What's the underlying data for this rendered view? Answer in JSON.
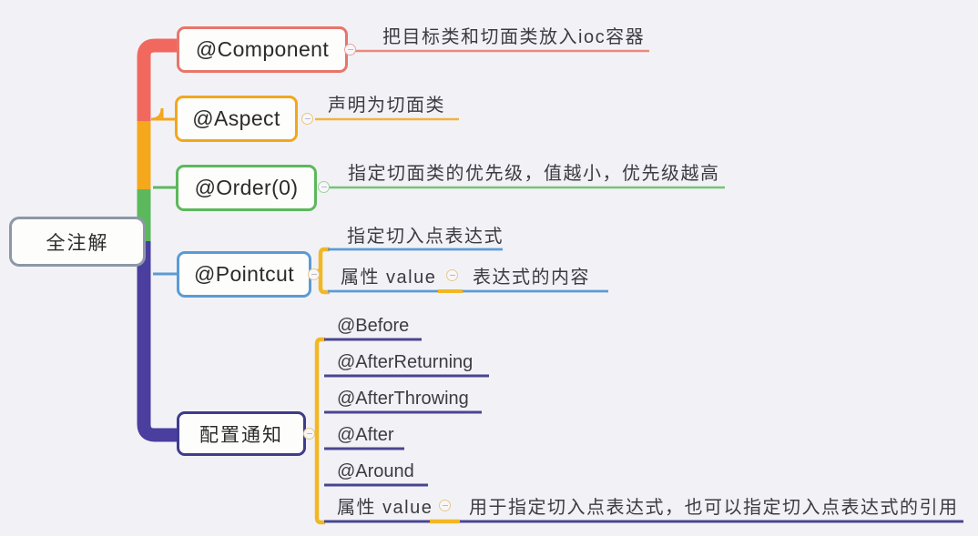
{
  "background": "#f2f2f6",
  "root": {
    "label": "全注解",
    "border_color": "#8d97a8"
  },
  "branches": [
    {
      "id": "component",
      "label": "@Component",
      "color": "#e8756a",
      "description": "把目标类和切面类放入ioc容器",
      "toggle": "collapse-toggle"
    },
    {
      "id": "aspect",
      "label": "@Aspect",
      "color": "#f2a71c",
      "description": "声明为切面类",
      "toggle": "collapse-toggle"
    },
    {
      "id": "order",
      "label": "@Order(0)",
      "color": "#5cb85c",
      "description": "指定切面类的优先级，值越小，优先级越高",
      "toggle": "collapse-toggle"
    },
    {
      "id": "pointcut",
      "label": "@Pointcut",
      "color": "#5b9bd5",
      "bracket_color": "#f2b723",
      "toggle": "collapse-toggle",
      "children": [
        {
          "label": "指定切入点表达式",
          "underline_color": "#5b9bd5"
        },
        {
          "label": "属性 value",
          "underline_color": "#5b9bd5",
          "toggle": "collapse-toggle",
          "detail": "表达式的内容"
        }
      ]
    },
    {
      "id": "advice",
      "label": "配置通知",
      "color": "#3f3c8c",
      "bracket_color": "#f2b723",
      "toggle": "collapse-toggle",
      "children": [
        {
          "label": "@Before",
          "underline_color": "#4a4591"
        },
        {
          "label": "@AfterReturning",
          "underline_color": "#4a4591"
        },
        {
          "label": "@AfterThrowing",
          "underline_color": "#4a4591"
        },
        {
          "label": "@After",
          "underline_color": "#4a4591"
        },
        {
          "label": "@Around",
          "underline_color": "#4a4591"
        },
        {
          "label": "属性 value",
          "underline_color": "#4a4591",
          "toggle": "collapse-toggle",
          "detail": "用于指定切入点表达式，也可以指定切入点表达式的引用"
        }
      ]
    }
  ],
  "trunk": {
    "segments": [
      {
        "color": "#f1695e"
      },
      {
        "color": "#f5a81c"
      },
      {
        "color": "#5cb85c"
      },
      {
        "color": "#4a3f9e"
      }
    ]
  }
}
